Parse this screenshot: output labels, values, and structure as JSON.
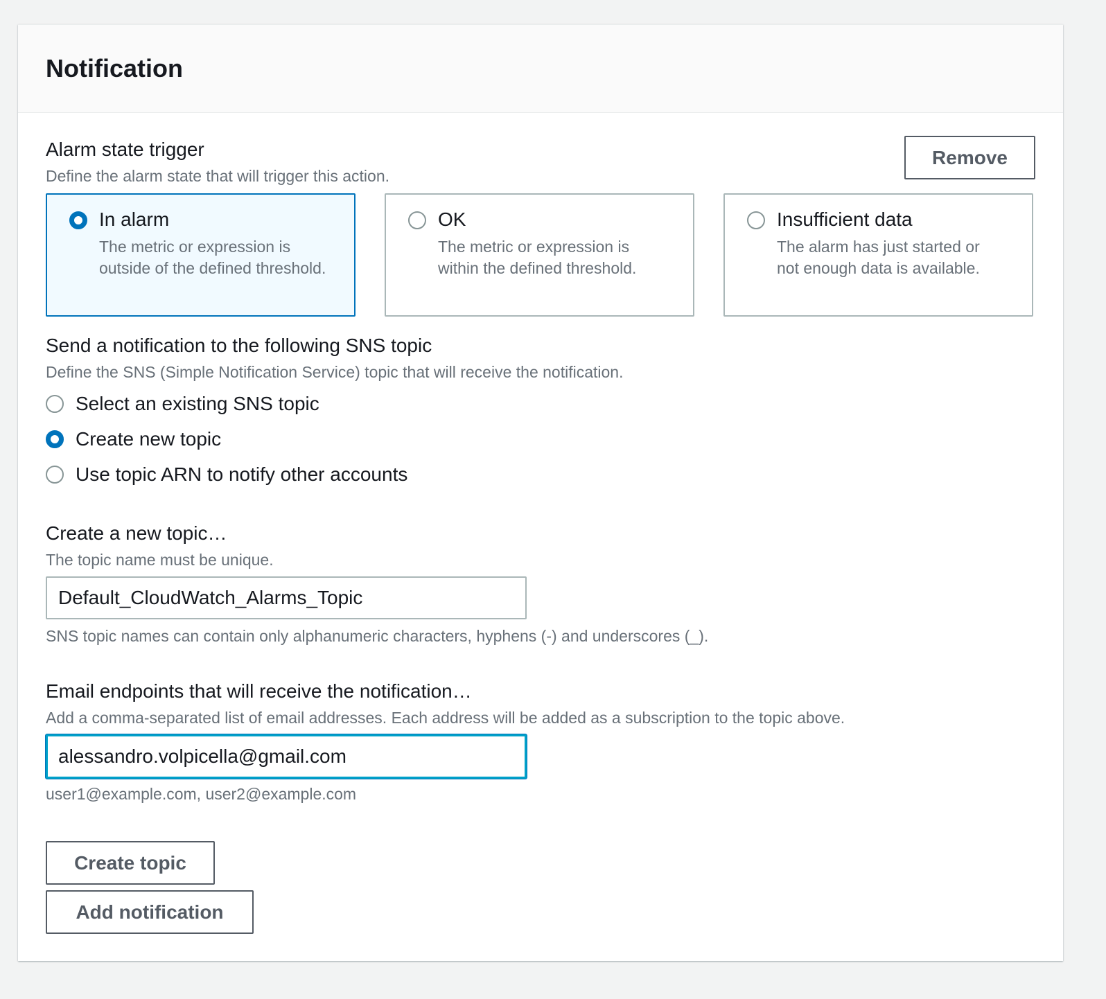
{
  "panel": {
    "title": "Notification"
  },
  "alarm_trigger": {
    "label": "Alarm state trigger",
    "description": "Define the alarm state that will trigger this action.",
    "remove_label": "Remove",
    "options": [
      {
        "label": "In alarm",
        "description": "The metric or expression is outside of the defined threshold.",
        "selected": true
      },
      {
        "label": "OK",
        "description": "The metric or expression is within the defined threshold.",
        "selected": false
      },
      {
        "label": "Insufficient data",
        "description": "The alarm has just started or not enough data is available.",
        "selected": false
      }
    ]
  },
  "sns": {
    "label": "Send a notification to the following SNS topic",
    "description": "Define the SNS (Simple Notification Service) topic that will receive the notification.",
    "options": [
      {
        "label": "Select an existing SNS topic",
        "selected": false
      },
      {
        "label": "Create new topic",
        "selected": true
      },
      {
        "label": "Use topic ARN to notify other accounts",
        "selected": false
      }
    ]
  },
  "new_topic": {
    "label": "Create a new topic…",
    "description": "The topic name must be unique.",
    "value": "Default_CloudWatch_Alarms_Topic",
    "constraint": "SNS topic names can contain only alphanumeric characters, hyphens (-) and underscores (_)."
  },
  "email": {
    "label": "Email endpoints that will receive the notification…",
    "description": "Add a comma-separated list of email addresses. Each address will be added as a subscription to the topic above.",
    "value": "alessandro.volpicella@gmail.com",
    "hint": "user1@example.com, user2@example.com"
  },
  "actions": {
    "create_topic_label": "Create topic",
    "add_notification_label": "Add notification"
  },
  "colors": {
    "accent": "#0073bb",
    "focus": "#00a1c9",
    "selected_tile_bg": "#f1faff",
    "border": "#aab7b8",
    "muted_text": "#687078"
  }
}
